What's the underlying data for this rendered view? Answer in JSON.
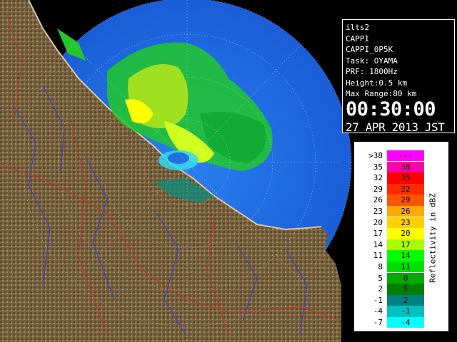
{
  "colors": {
    "land": "#7a6340",
    "sea_echo": "#1f6fe0",
    "rivers": "#3a40c8",
    "boundaries": "#c8302a"
  },
  "info": {
    "site": "ilts2",
    "product": "CAPPI",
    "product_name": "CAPPI_0P5K",
    "task": "Task: OYAMA",
    "prf": "PRF: 1800Hz",
    "height": "Height:0.5 km",
    "max_range": "Max Range:80 km",
    "time": "00:30:00",
    "date": "27 APR 2013 JST"
  },
  "legend": {
    "unit_label": "Reflectivity in dBZ",
    "rows": [
      {
        "lo": ">38",
        "hi": "---",
        "color": "#ff00ff"
      },
      {
        "lo": "35",
        "hi": "38",
        "color": "#ff00aa"
      },
      {
        "lo": "32",
        "hi": "35",
        "color": "#ff0000"
      },
      {
        "lo": "29",
        "hi": "32",
        "color": "#ff2a00"
      },
      {
        "lo": "26",
        "hi": "29",
        "color": "#ff5500"
      },
      {
        "lo": "23",
        "hi": "26",
        "color": "#ffaa00"
      },
      {
        "lo": "20",
        "hi": "23",
        "color": "#ffd000"
      },
      {
        "lo": "17",
        "hi": "20",
        "color": "#ffff00"
      },
      {
        "lo": "14",
        "hi": "17",
        "color": "#aaff00"
      },
      {
        "lo": "11",
        "hi": "14",
        "color": "#00ff00"
      },
      {
        "lo": "8",
        "hi": "11",
        "color": "#00dd00"
      },
      {
        "lo": "5",
        "hi": "8",
        "color": "#00aa00"
      },
      {
        "lo": "2",
        "hi": "5",
        "color": "#007f00"
      },
      {
        "lo": "-1",
        "hi": "2",
        "color": "#008080"
      },
      {
        "lo": "-4",
        "hi": "-1",
        "color": "#00c0c0"
      },
      {
        "lo": "-7",
        "hi": "-4",
        "color": "#00ffff"
      }
    ]
  }
}
